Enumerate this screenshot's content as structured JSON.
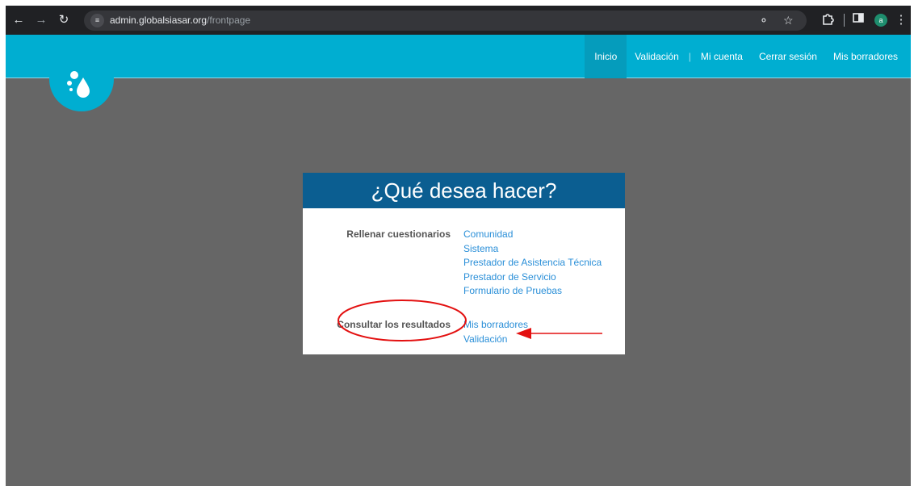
{
  "browser": {
    "url_host": "admin.globalsiasar.org",
    "url_path": "/frontpage",
    "back_icon": "arrow-left-icon",
    "forward_icon": "arrow-right-icon",
    "reload_icon": "reload-icon",
    "key_icon": "key-icon",
    "star_icon": "star-icon",
    "extensions_icon": "puzzle-icon",
    "sidepanel_icon": "side-panel-icon",
    "menu_icon": "kebab-menu-icon",
    "profile_initial": "a"
  },
  "nav": {
    "inicio": "Inicio",
    "validacion": "Validación",
    "separator": "|",
    "mi_cuenta": "Mi cuenta",
    "cerrar_sesion": "Cerrar sesión",
    "mis_borradores": "Mis borradores"
  },
  "card": {
    "title": "¿Qué desea hacer?",
    "fill_label": "Rellenar cuestionarios",
    "fill_links": [
      "Comunidad",
      "Sistema",
      "Prestador de Asistencia Técnica",
      "Prestador de Servicio",
      "Formulario de Pruebas"
    ],
    "results_label": "Consultar los resultados",
    "results_links": [
      "Mis borradores",
      "Validación"
    ]
  },
  "colors": {
    "header": "#00aed1",
    "card_header": "#0b5e91",
    "link": "#2a8fd8",
    "annotation": "#e31010",
    "page_bg": "#666666"
  }
}
